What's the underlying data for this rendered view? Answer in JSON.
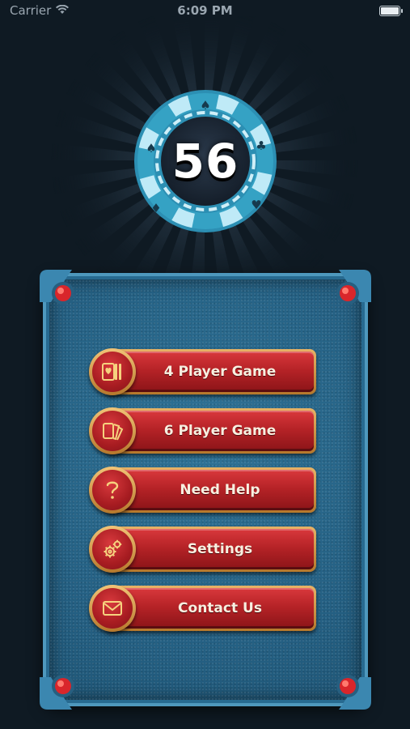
{
  "status_bar": {
    "carrier": "Carrier",
    "time": "6:09 PM"
  },
  "chip": {
    "number": "56"
  },
  "menu": {
    "items": [
      {
        "label": "4 Player Game",
        "icon": "cards-icon"
      },
      {
        "label": "6 Player Game",
        "icon": "card-fan-icon"
      },
      {
        "label": "Need Help",
        "icon": "question-icon"
      },
      {
        "label": "Settings",
        "icon": "gears-icon"
      },
      {
        "label": "Contact Us",
        "icon": "envelope-icon"
      }
    ]
  },
  "colors": {
    "background": "#0f1a23",
    "chip_ring": "#35a2c4",
    "board": "#276a90",
    "button_red": "#b62327",
    "button_gold": "#e7b366"
  }
}
